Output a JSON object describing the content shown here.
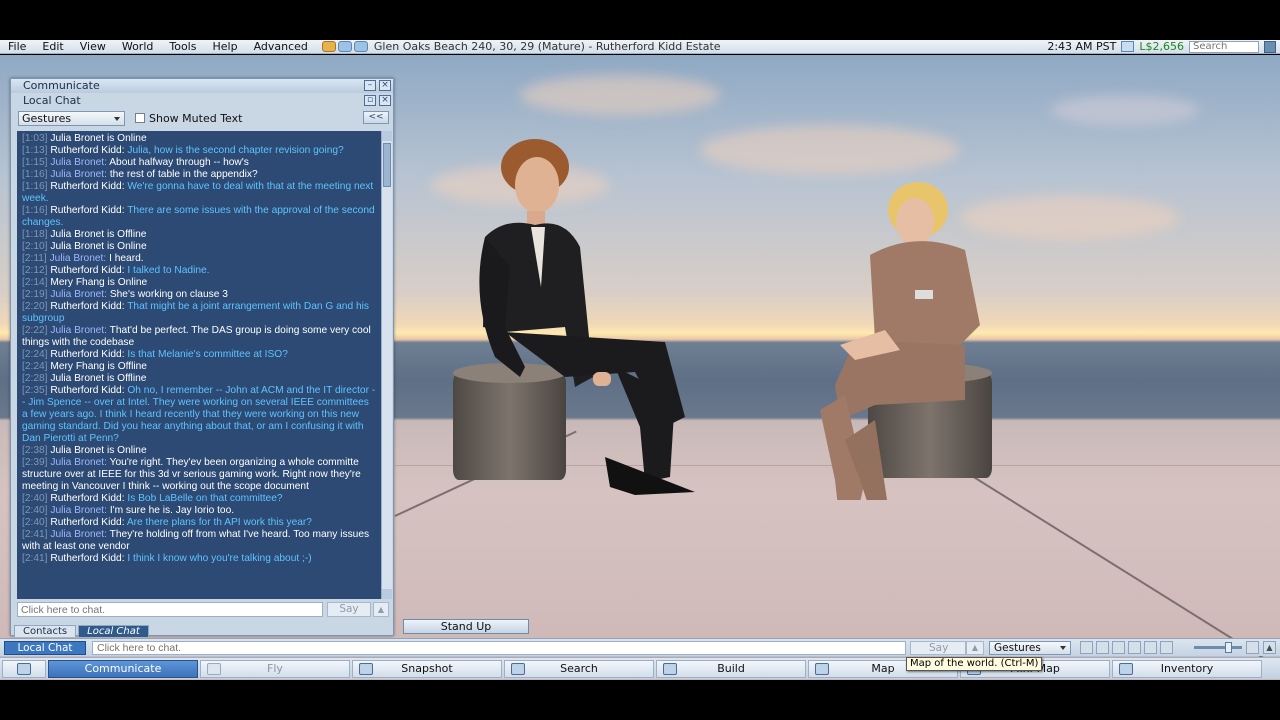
{
  "menubar": {
    "items": [
      "File",
      "Edit",
      "View",
      "World",
      "Tools",
      "Help",
      "Advanced"
    ],
    "location": "Glen Oaks Beach 240, 30, 29 (Mature) - Rutherford Kidd Estate",
    "time": "2:43 AM PST",
    "balance": "L$2,656",
    "search_placeholder": "Search"
  },
  "communicate": {
    "title": "Communicate",
    "subtitle": "Local Chat",
    "gestures_label": "Gestures",
    "show_muted_label": "Show Muted Text",
    "collapse_label": "<<",
    "chat_input_placeholder": "Click here to chat.",
    "say_label": "Say",
    "tabs": [
      "Contacts",
      "Local Chat"
    ],
    "log": [
      {
        "t": "[1:03]",
        "name": "Julia Bronet is Online",
        "text": "",
        "ns": "rk",
        "ts2": ""
      },
      {
        "t": "[1:13]",
        "name": "Rutherford Kidd:",
        "text": "Julia, how is the second chapter revision going?",
        "ns": "rk",
        "ts2": "blue"
      },
      {
        "t": "[1:15]",
        "name": "Julia Bronet:",
        "text": "About halfway through -- how's",
        "ns": "jb",
        "ts2": "white"
      },
      {
        "t": "[1:16]",
        "name": "Julia Bronet:",
        "text": "the rest of table in the appendix?",
        "ns": "jb",
        "ts2": "white"
      },
      {
        "t": "[1:16]",
        "name": "Rutherford Kidd:",
        "text": "We're gonna have to deal with that at the meeting next week.",
        "ns": "rk",
        "ts2": "blue"
      },
      {
        "t": "[1:16]",
        "name": "Rutherford Kidd:",
        "text": "There are some issues with the approval of the second changes.",
        "ns": "rk",
        "ts2": "blue"
      },
      {
        "t": "[1:18]",
        "name": "Julia Bronet is Offline",
        "text": "",
        "ns": "rk",
        "ts2": ""
      },
      {
        "t": "[2:10]",
        "name": "Julia Bronet is Online",
        "text": "",
        "ns": "rk",
        "ts2": ""
      },
      {
        "t": "[2:11]",
        "name": "Julia Bronet:",
        "text": "I heard.",
        "ns": "jb",
        "ts2": "white"
      },
      {
        "t": "[2:12]",
        "name": "Rutherford Kidd:",
        "text": "I talked to Nadine.",
        "ns": "rk",
        "ts2": "blue"
      },
      {
        "t": "[2:14]",
        "name": "Mery Fhang is Online",
        "text": "",
        "ns": "rk",
        "ts2": ""
      },
      {
        "t": "[2:19]",
        "name": "Julia Bronet:",
        "text": "She's working on clause 3",
        "ns": "jb",
        "ts2": "white"
      },
      {
        "t": "[2:20]",
        "name": "Rutherford Kidd:",
        "text": "That might be a joint arrangement with Dan G and his subgroup",
        "ns": "rk",
        "ts2": "blue"
      },
      {
        "t": "[2:22]",
        "name": "Julia Bronet:",
        "text": "That'd be perfect. The DAS group is doing some very cool things with the codebase",
        "ns": "jb",
        "ts2": "white"
      },
      {
        "t": "[2:24]",
        "name": "Rutherford Kidd:",
        "text": "Is that Melanie's committee at ISO?",
        "ns": "rk",
        "ts2": "blue"
      },
      {
        "t": "[2:24]",
        "name": "Mery Fhang is Offline",
        "text": "",
        "ns": "rk",
        "ts2": ""
      },
      {
        "t": "[2:28]",
        "name": "Julia Bronet is Offline",
        "text": "",
        "ns": "rk",
        "ts2": ""
      },
      {
        "t": "[2:35]",
        "name": "Rutherford Kidd:",
        "text": "Oh no, I remember -- John at ACM and the IT director -- Jim Spence -- over at Intel. They were working on several IEEE committees a few years ago. I think I heard recently that they were working on this new gaming standard. Did you hear anything about that, or am I confusing it with Dan Pierotti at Penn?",
        "ns": "rk",
        "ts2": "blue"
      },
      {
        "t": "[2:38]",
        "name": "Julia Bronet is Online",
        "text": "",
        "ns": "rk",
        "ts2": ""
      },
      {
        "t": "[2:39]",
        "name": "Julia Bronet:",
        "text": "You're right. They'ev been organizing a whole committe structure over at IEEE for this 3d vr serious gaming work. Right now they're meeting in Vancouver I think -- working out the scope document",
        "ns": "jb",
        "ts2": "white"
      },
      {
        "t": "[2:40]",
        "name": "Rutherford Kidd:",
        "text": "Is Bob LaBelle on that committee?",
        "ns": "rk",
        "ts2": "blue"
      },
      {
        "t": "[2:40]",
        "name": "Julia Bronet:",
        "text": "I'm sure he is. Jay Iorio too.",
        "ns": "jb",
        "ts2": "white"
      },
      {
        "t": "[2:40]",
        "name": "Rutherford Kidd:",
        "text": "Are there plans for th API work this year?",
        "ns": "rk",
        "ts2": "blue"
      },
      {
        "t": "[2:41]",
        "name": "Julia Bronet:",
        "text": "They're holding off from what I've heard. Too many issues with at least one vendor",
        "ns": "jb",
        "ts2": "white"
      },
      {
        "t": "[2:41]",
        "name": "Rutherford Kidd:",
        "text": "I think I know who you're talking about ;-)",
        "ns": "rk",
        "ts2": "blue"
      }
    ]
  },
  "standup_label": "Stand Up",
  "chatbar": {
    "local_chat_label": "Local Chat",
    "input_placeholder": "Click here to chat.",
    "say_label": "Say",
    "gestures_label": "Gestures"
  },
  "toolbar": {
    "buttons": [
      "Communicate",
      "Fly",
      "Snapshot",
      "Search",
      "Build",
      "Map",
      "Mini-Map",
      "Inventory"
    ]
  },
  "tooltip": "Map of the world. (Ctrl-M)"
}
